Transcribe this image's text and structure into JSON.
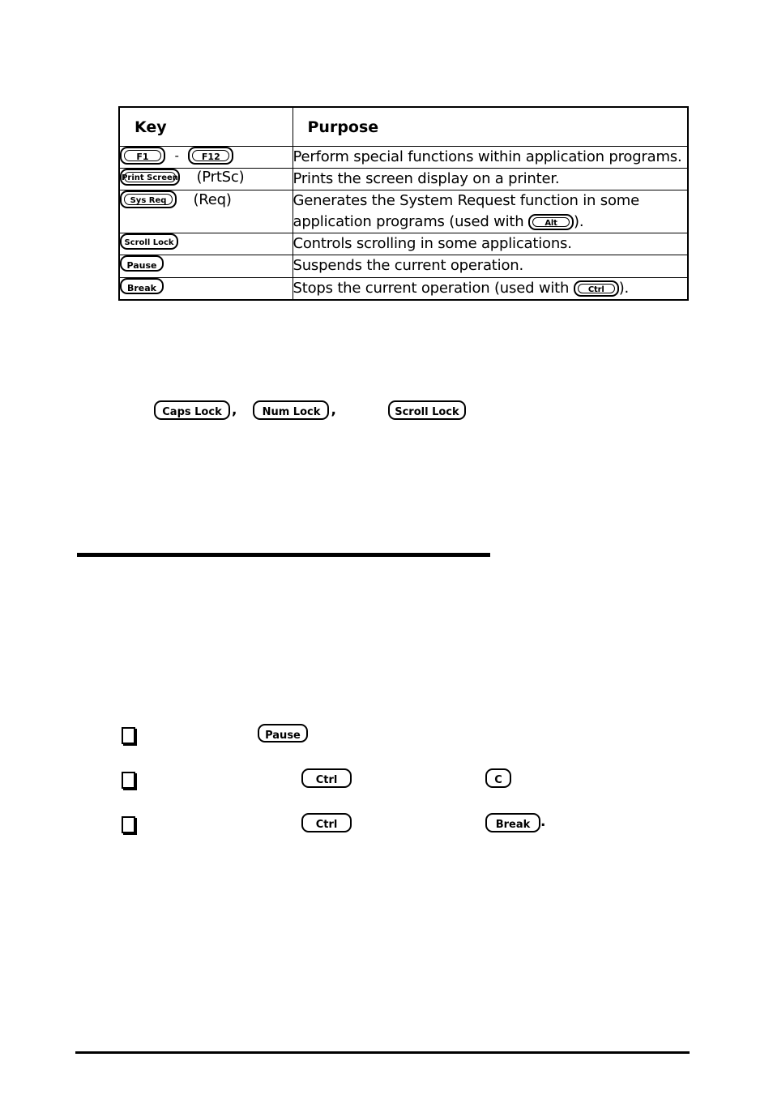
{
  "document": {
    "type": "printed-manual-page"
  },
  "table": {
    "headers": [
      "Key",
      "Purpose"
    ],
    "rows": [
      {
        "key_caps": [
          "F1",
          "F12"
        ],
        "key_separator": "-",
        "key_alias": "",
        "purpose_text": "Perform special functions within application programs.",
        "purpose_inline_key": "",
        "purpose_suffix": ""
      },
      {
        "key_caps": [
          "Print Screen"
        ],
        "key_separator": "",
        "key_alias": "(PrtSc)",
        "purpose_text": "Prints the screen display on a printer.",
        "purpose_inline_key": "",
        "purpose_suffix": ""
      },
      {
        "key_caps": [
          "Sys Req"
        ],
        "key_separator": "",
        "key_alias": "(Req)",
        "purpose_text": "Generates the System Request function in some application programs (used with ",
        "purpose_inline_key": "Alt",
        "purpose_suffix": ")."
      },
      {
        "key_caps": [
          "Scroll Lock"
        ],
        "key_separator": "",
        "key_alias": "",
        "purpose_text": "Controls scrolling in some applications.",
        "purpose_inline_key": "",
        "purpose_suffix": ""
      },
      {
        "key_caps": [
          "Pause"
        ],
        "key_separator": "",
        "key_alias": "",
        "purpose_text": "Suspends the current operation.",
        "purpose_inline_key": "",
        "purpose_suffix": ""
      },
      {
        "key_caps": [
          "Break"
        ],
        "key_separator": "",
        "key_alias": "",
        "purpose_text": "Stops the current operation (used with ",
        "purpose_inline_key": "Ctrl",
        "purpose_suffix": ")."
      }
    ]
  },
  "lock_keys_row": {
    "keys": [
      "Caps Lock",
      "Num Lock",
      "Scroll Lock"
    ],
    "separator_1": ",",
    "separator_2": ","
  },
  "bullet_list": {
    "items": [
      {
        "keys": [
          "Pause"
        ],
        "trailing_punctuation": ""
      },
      {
        "keys": [
          "Ctrl",
          "C"
        ],
        "trailing_punctuation": ""
      },
      {
        "keys": [
          "Ctrl",
          "Break"
        ],
        "trailing_punctuation": "."
      }
    ]
  },
  "colors": {
    "ink": "#000000",
    "paper": "#ffffff"
  }
}
